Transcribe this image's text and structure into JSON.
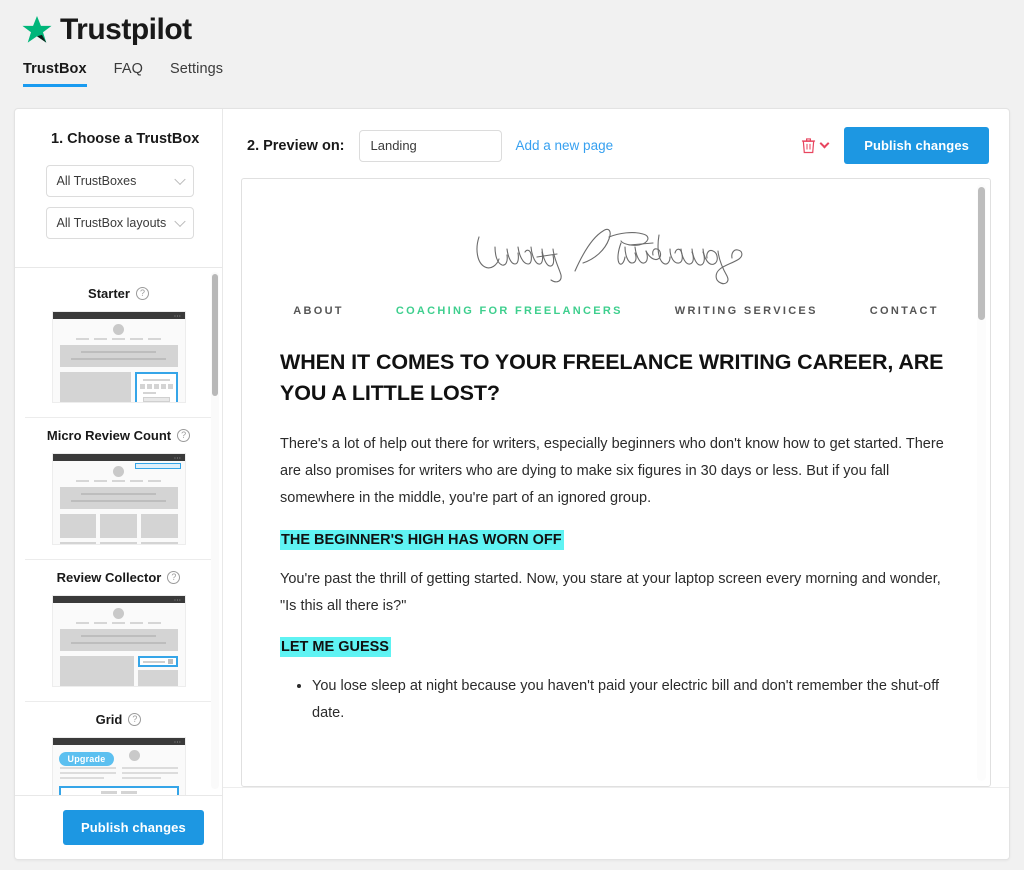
{
  "header": {
    "brand": "Trustpilot",
    "star_icon": "star-icon",
    "nav": [
      {
        "label": "TrustBox",
        "active": true
      },
      {
        "label": "FAQ",
        "active": false
      },
      {
        "label": "Settings",
        "active": false
      }
    ]
  },
  "sidebar": {
    "title": "1. Choose a TrustBox",
    "filters": [
      {
        "name": "trustbox-filter",
        "value": "All TrustBoxes"
      },
      {
        "name": "layout-filter",
        "value": "All TrustBox layouts"
      }
    ],
    "trustboxes": [
      {
        "label": "Starter",
        "help": "?"
      },
      {
        "label": "Micro Review Count",
        "help": "?"
      },
      {
        "label": "Review Collector",
        "help": "?"
      },
      {
        "label": "Grid",
        "help": "?",
        "badge": "Upgrade"
      }
    ],
    "publish_label": "Publish changes"
  },
  "preview_bar": {
    "step_label": "2. Preview on:",
    "page_select_value": "Landing",
    "add_page_label": "Add a new page",
    "delete_icon": "trash-icon",
    "delete_chevron_icon": "chevron-down-icon",
    "publish_label": "Publish changes"
  },
  "preview": {
    "site_logo_text": "Lindsay Pietroluongo",
    "site_nav": [
      {
        "label": "ABOUT",
        "active": false
      },
      {
        "label": "COACHING FOR FREELANCERS",
        "active": true
      },
      {
        "label": "WRITING SERVICES",
        "active": false
      },
      {
        "label": "CONTACT",
        "active": false
      }
    ],
    "article": {
      "heading": "WHEN IT COMES TO YOUR FREELANCE WRITING CAREER, ARE YOU A LITTLE LOST?",
      "paragraph1": "There's a lot of help out there for writers, especially beginners who don't know how to get started. There are also promises for writers who are dying to make six figures in 30 days or less. But if you fall somewhere in the middle, you're part of an ignored group.",
      "subhead1": "THE BEGINNER'S HIGH HAS WORN OFF",
      "paragraph2": "You're past the thrill of getting started. Now, you stare at your laptop screen every morning and wonder, \"Is this all there is?\"",
      "subhead2": "LET ME GUESS",
      "bullets": [
        "You lose sleep at night because you haven't paid your electric bill and don't remember the shut-off date."
      ]
    }
  },
  "colors": {
    "brand_green": "#00b67a",
    "accent_blue": "#1d97e2",
    "link_blue": "#36a0f0",
    "delete_red": "#e8455f",
    "site_green": "#3ecf8e",
    "highlight_cyan": "#5ff3f3"
  }
}
